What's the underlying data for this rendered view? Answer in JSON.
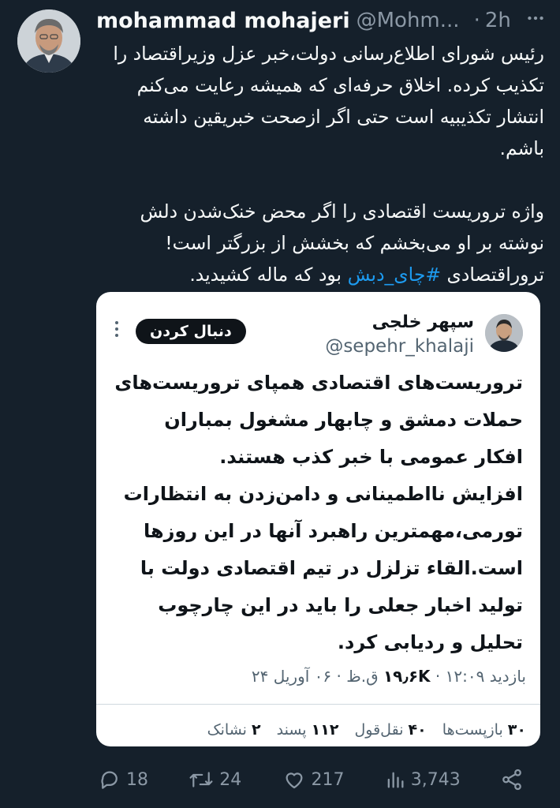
{
  "tweet": {
    "author_name": "mohammad mohajeri",
    "author_handle": "@Mohm...",
    "separator": "·",
    "time": "2h",
    "text_para1": "رئیس شورای اطلاع‌رسانی دولت،خبر عزل وزیراقتصاد را تکذیب کرده. اخلاق حرفه‌ای که همیشه رعایت می‌کنم انتشار تکذیبیه است حتی اگر ازصحت خبریقین داشته باشم.",
    "text_para2_before": "واژه تروریست اقتصادی را اگر محض خنک‌شدن دلش نوشته بر او می‌بخشم که بخشش از بزرگتر است! تروراقتصادی ",
    "hashtag": "#چای_دبش",
    "text_para2_after": " بود که ماله کشیدید."
  },
  "quote": {
    "author_name": "سپهر خلجی",
    "author_handle": "@sepehr_khalaji",
    "follow_label": "دنبال کردن",
    "text_para1": "تروریست‌های اقتصادی همپای تروریست‌های حملات دمشق و چابهار مشغول بمباران افکار عمومی با خبر کذب هستند.",
    "text_para2": "افزایش نااطمینانی و دامن‌زدن به انتظارات تورمی،مهمترین راهبرد آنها در این روزها است.القاء تزلزل در تیم اقتصادی دولت با تولید اخبار جعلی را باید در این چارچوب تحلیل و ردیابی کرد.",
    "date": "۰۶ آوریل ۲۴",
    "time_text": "۱۲:۰۹ ق.ظ",
    "views_count": "۱۹٫۶K",
    "views_label": "بازدید",
    "reposts_count": "۳۰",
    "reposts_label": "بازپست‌ها",
    "quotes_count": "۴۰",
    "quotes_label": "نقل‌قول",
    "likes_count": "۱۱۲",
    "likes_label": "پسند",
    "bookmarks_count": "۲",
    "bookmarks_label": "نشانک"
  },
  "actions": {
    "replies": "18",
    "retweets": "24",
    "likes": "217",
    "views": "3,743"
  },
  "icons": {
    "more": "more-icon",
    "reply": "reply-icon",
    "retweet": "retweet-icon",
    "like": "heart-icon",
    "views": "views-icon",
    "share": "share-icon"
  },
  "colors": {
    "background": "#15202b",
    "accent": "#1d9bf0",
    "secondary_text": "#8b98a5",
    "card_background": "#ffffff"
  }
}
